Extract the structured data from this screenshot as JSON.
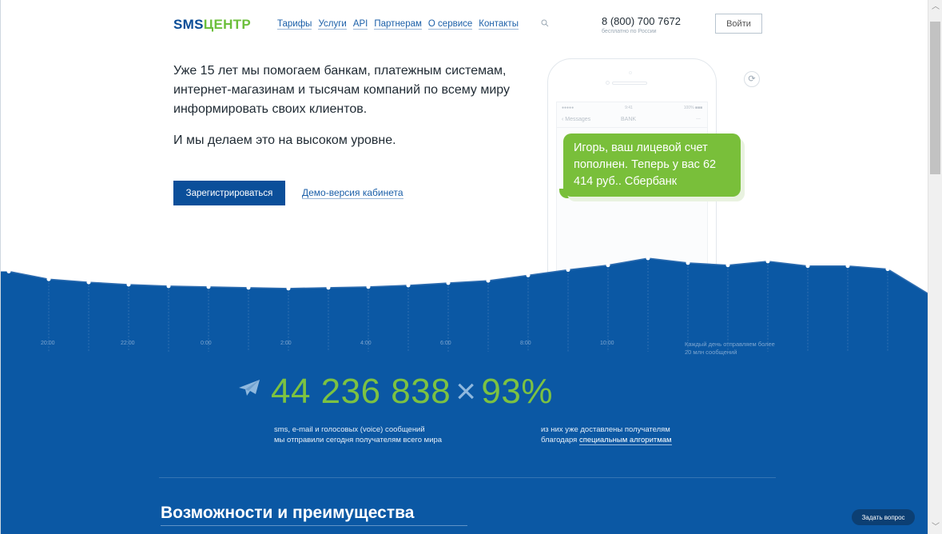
{
  "header": {
    "logo_main": "SMS",
    "logo_accent": "ЦЕНТР",
    "nav": [
      "Тарифы",
      "Услуги",
      "API",
      "Партнерам",
      "О сервисе",
      "Контакты"
    ],
    "phone": "8 (800) 700 7672",
    "phone_note": "бесплатно по России",
    "login_label": "Войти"
  },
  "hero": {
    "paragraph1": "Уже 15 лет мы помогаем банкам, платежным системам, интернет-магазинам и тысячам компаний по всему миру информировать своих клиентов.",
    "paragraph2": "И мы делаем это на высоком уровне.",
    "register_label": "Зарегистрироваться",
    "demo_label": "Демо-версия кабинета"
  },
  "phone_mock": {
    "status_left": "●●●●● ",
    "status_time": "9:41",
    "status_right": "100% ■■■",
    "back_label": "Messages",
    "contact": "BANK",
    "menu": "...",
    "bubble_text": "Игорь, ваш лицевой счет пополнен. Теперь у вас 62 414 руб.. Сбербанк"
  },
  "chart_data": {
    "type": "area",
    "title": "",
    "x": [
      "",
      "20:00",
      "",
      "22:00",
      "",
      "0:00",
      "",
      "2:00",
      "",
      "4:00",
      "",
      "6:00",
      "",
      "8:00",
      "",
      "10:00",
      "",
      "",
      "",
      "",
      "",
      "",
      "",
      ""
    ],
    "y_relative": [
      0.17,
      0.27,
      0.31,
      0.34,
      0.36,
      0.37,
      0.38,
      0.39,
      0.38,
      0.37,
      0.35,
      0.32,
      0.29,
      0.22,
      0.15,
      0.09,
      0.0,
      0.06,
      0.09,
      0.04,
      0.1,
      0.1,
      0.14,
      0.46
    ],
    "xlabel": "",
    "ylabel": "",
    "annotation": "Каждый день отправляем более 20 млн сообщений",
    "color": "#0b58a4"
  },
  "stats": {
    "messages_count": "44 236 838",
    "separator": "×",
    "delivered_percent": "93%",
    "messages_line1": "sms, e-mail и голосовых (voice) сообщений",
    "messages_line2": "мы отправили сегодня получателям всего мира",
    "delivered_line1": "из них уже доставлены получателям",
    "delivered_line2_prefix": "благодаря",
    "delivered_link": "специальным алгоритмам"
  },
  "features": {
    "title": "Возможности и преимущества"
  },
  "ask_button": "Задать вопрос",
  "colors": {
    "brand_blue": "#0b58a4",
    "brand_green": "#7cc242",
    "bubble_green": "#79bf3a"
  }
}
